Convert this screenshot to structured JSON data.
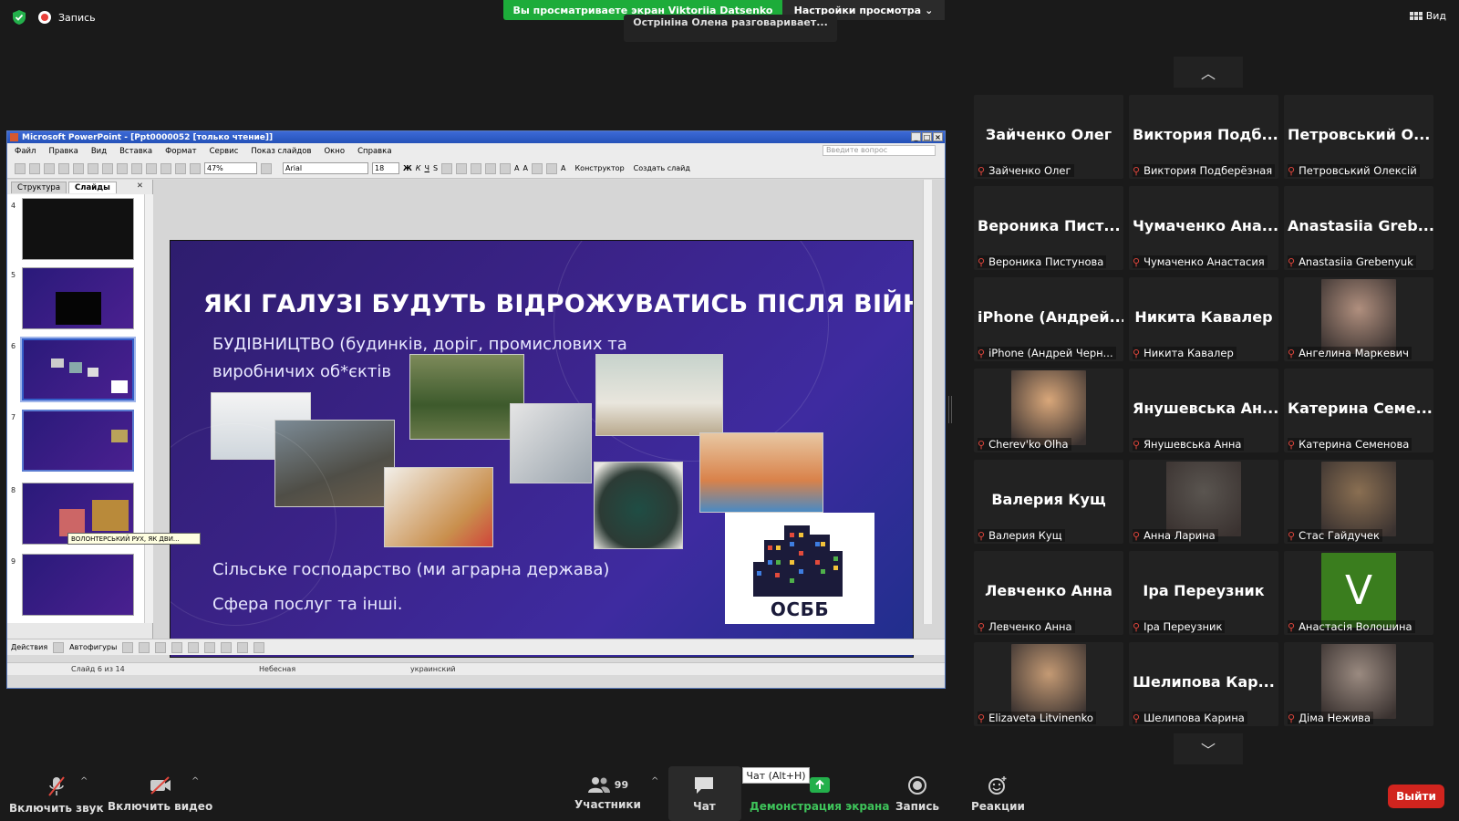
{
  "topbar": {
    "recording_label": "Запись",
    "share_banner": "Вы просматриваете экран Viktoriia Datsenko",
    "view_settings": "Настройки просмотра",
    "speaking_now": "Острініна Олена разговаривает...",
    "view_label": "Вид"
  },
  "ppt": {
    "window_title": "Microsoft PowerPoint - [Ppt0000052 [только чтение]]",
    "menu": [
      "Файл",
      "Правка",
      "Вид",
      "Вставка",
      "Формат",
      "Сервис",
      "Показ слайдов",
      "Окно",
      "Справка"
    ],
    "ask_placeholder": "Введите вопрос",
    "zoom": "47%",
    "font": "Arial",
    "font_size": "18",
    "designer_label": "Конструктор",
    "new_slide_label": "Создать слайд",
    "tabs": {
      "outline": "Структура",
      "slides": "Слайды"
    },
    "thumb_numbers": [
      "4",
      "5",
      "6",
      "7",
      "8",
      "9"
    ],
    "tooltip": "ВОЛОНТЕРСЬКИЙ РУХ, ЯК ДВИ...",
    "actions_label": "Действия",
    "autoshapes_label": "Автофигуры",
    "status": {
      "slide": "Слайд 6 из 14",
      "design": "Небесная",
      "language": "украинский"
    }
  },
  "slide": {
    "title": "ЯКІ ГАЛУЗІ  БУДУТЬ ВІДРОЖУВАТИСЬ ПІСЛЯ ВІЙНИ",
    "subtitle": "БУДІВНИЦТВО (будинків, доріг, промислових та виробничих об*єктів",
    "line2": "Сільське господарство (ми аграрна держава)",
    "line3": "Сфера послуг та інші.",
    "osbb": "ОСББ"
  },
  "gallery": [
    {
      "big": "Зайченко Олег",
      "label": "Зайченко Олег",
      "video": false
    },
    {
      "big": "Виктория Подб...",
      "label": "Виктория Подберёзная",
      "video": false
    },
    {
      "big": "Петровський О...",
      "label": "Петровський Олексій",
      "video": false
    },
    {
      "big": "Вероника Пист...",
      "label": "Вероника Пистунова",
      "video": false
    },
    {
      "big": "Чумаченко Ана...",
      "label": "Чумаченко Анастасия",
      "video": false
    },
    {
      "big": "Anastasiia Greb...",
      "label": "Anastasiia Grebenyuk",
      "video": false
    },
    {
      "big": "iPhone (Андрей...",
      "label": "iPhone (Андрей Черн...",
      "video": false
    },
    {
      "big": "Никита Кавалер",
      "label": "Никита Кавалер",
      "video": false
    },
    {
      "big": "",
      "label": "Ангелина Маркевич",
      "video": true,
      "video_color": "#b08f7e"
    },
    {
      "big": "",
      "label": "Cherev'ko Olha",
      "video": true,
      "video_color": "#d9a77a"
    },
    {
      "big": "Янушевська Ан...",
      "label": "Янушевська Анна",
      "video": false
    },
    {
      "big": "Катерина Семе...",
      "label": "Катерина Семенова",
      "video": false
    },
    {
      "big": "Валерия Кущ",
      "label": "Валерия Кущ",
      "video": false
    },
    {
      "big": "",
      "label": "Анна Ларина",
      "video": true,
      "video_color": "#5a5550"
    },
    {
      "big": "",
      "label": "Стас Гайдучек",
      "video": true,
      "video_color": "#8a6f52"
    },
    {
      "big": "Левченко Анна",
      "label": "Левченко Анна",
      "video": false
    },
    {
      "big": "Іра Переузник",
      "label": "Іра Переузник",
      "video": false
    },
    {
      "big": "",
      "label": "Анастасія Волошина",
      "video": false,
      "initial": "V",
      "initial_color": "#3a7d1e"
    },
    {
      "big": "",
      "label": "Elizaveta Litvinenko",
      "video": true,
      "video_color": "#c49a74"
    },
    {
      "big": "Шелипова Кар...",
      "label": "Шелипова Карина",
      "video": false
    },
    {
      "big": "",
      "label": "Діма Нежива",
      "video": true,
      "video_color": "#9a8a80"
    }
  ],
  "bottombar": {
    "mute": "Включить звук",
    "video": "Включить видео",
    "participants": "Участники",
    "participants_count": "99",
    "chat": "Чат",
    "chat_tooltip": "Чат (Alt+H)",
    "share": "Демонстрация экрана",
    "record": "Запись",
    "reactions": "Реакции",
    "leave": "Выйти"
  }
}
